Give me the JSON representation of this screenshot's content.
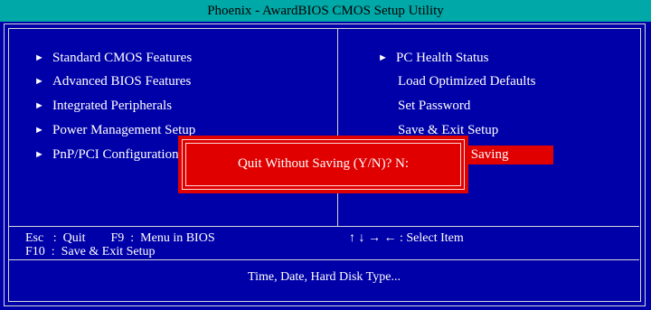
{
  "title": "Phoenix - AwardBIOS CMOS Setup Utility",
  "menu_left": [
    {
      "label": "Standard CMOS Features",
      "arrow": "►"
    },
    {
      "label": "Advanced BIOS Features",
      "arrow": "►"
    },
    {
      "label": "Integrated Peripherals",
      "arrow": "►"
    },
    {
      "label": "Power Management Setup",
      "arrow": "►"
    },
    {
      "label": "PnP/PCI Configurations",
      "arrow": "►"
    }
  ],
  "menu_right": [
    {
      "label": "PC Health Status",
      "arrow": "►"
    },
    {
      "label": "Load Optimized Defaults",
      "arrow": ""
    },
    {
      "label": "Set Password",
      "arrow": ""
    },
    {
      "label": "Save & Exit Setup",
      "arrow": ""
    },
    {
      "label": "Exit Without Saving",
      "arrow": "",
      "selected": true
    }
  ],
  "hints": {
    "line1": "Esc   :  Quit        F9  :  Menu in BIOS",
    "line2": "F10  :  Save & Exit Setup",
    "nav": "↑ ↓ → ← : Select Item"
  },
  "status": "Time, Date, Hard Disk Type...",
  "dialog": {
    "message": "Quit Without Saving (Y/N)? N:"
  },
  "colors": {
    "background": "#0000a8",
    "title_bar": "#00a8a8",
    "highlight": "#e00000",
    "text": "#ffffff"
  }
}
